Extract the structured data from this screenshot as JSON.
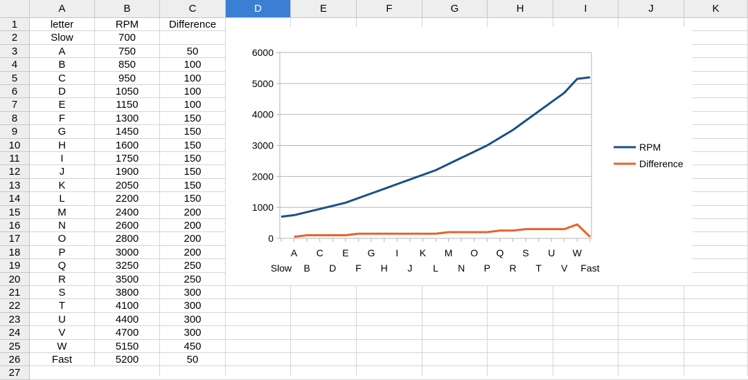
{
  "columns": [
    "A",
    "B",
    "C",
    "D",
    "E",
    "F",
    "G",
    "H",
    "I",
    "J",
    "K"
  ],
  "selected_column": "D",
  "row_numbers": [
    "1",
    "2",
    "3",
    "4",
    "5",
    "6",
    "7",
    "8",
    "9",
    "10",
    "11",
    "12",
    "13",
    "14",
    "15",
    "16",
    "17",
    "18",
    "19",
    "20",
    "21",
    "22",
    "23",
    "24",
    "25",
    "26",
    "27"
  ],
  "table": {
    "headers": [
      "letter",
      "RPM",
      "Difference"
    ],
    "rows": [
      [
        "Slow",
        "700",
        ""
      ],
      [
        "A",
        "750",
        "50"
      ],
      [
        "B",
        "850",
        "100"
      ],
      [
        "C",
        "950",
        "100"
      ],
      [
        "D",
        "1050",
        "100"
      ],
      [
        "E",
        "1150",
        "100"
      ],
      [
        "F",
        "1300",
        "150"
      ],
      [
        "G",
        "1450",
        "150"
      ],
      [
        "H",
        "1600",
        "150"
      ],
      [
        "I",
        "1750",
        "150"
      ],
      [
        "J",
        "1900",
        "150"
      ],
      [
        "K",
        "2050",
        "150"
      ],
      [
        "L",
        "2200",
        "150"
      ],
      [
        "M",
        "2400",
        "200"
      ],
      [
        "N",
        "2600",
        "200"
      ],
      [
        "O",
        "2800",
        "200"
      ],
      [
        "P",
        "3000",
        "200"
      ],
      [
        "Q",
        "3250",
        "250"
      ],
      [
        "R",
        "3500",
        "250"
      ],
      [
        "S",
        "3800",
        "300"
      ],
      [
        "T",
        "4100",
        "300"
      ],
      [
        "U",
        "4400",
        "300"
      ],
      [
        "V",
        "4700",
        "300"
      ],
      [
        "W",
        "5150",
        "450"
      ],
      [
        "Fast",
        "5200",
        "50"
      ]
    ]
  },
  "chart_data": {
    "type": "line",
    "categories": [
      "Slow",
      "A",
      "B",
      "C",
      "D",
      "E",
      "F",
      "G",
      "H",
      "I",
      "J",
      "K",
      "L",
      "M",
      "N",
      "O",
      "P",
      "Q",
      "R",
      "S",
      "T",
      "U",
      "V",
      "W",
      "Fast"
    ],
    "series": [
      {
        "name": "RPM",
        "color": "#1a4f86",
        "values": [
          700,
          750,
          850,
          950,
          1050,
          1150,
          1300,
          1450,
          1600,
          1750,
          1900,
          2050,
          2200,
          2400,
          2600,
          2800,
          3000,
          3250,
          3500,
          3800,
          4100,
          4400,
          4700,
          5150,
          5200
        ]
      },
      {
        "name": "Difference",
        "color": "#e8622a",
        "values": [
          null,
          50,
          100,
          100,
          100,
          100,
          150,
          150,
          150,
          150,
          150,
          150,
          150,
          200,
          200,
          200,
          200,
          250,
          250,
          300,
          300,
          300,
          300,
          450,
          50
        ]
      }
    ],
    "ylim": [
      0,
      6000
    ],
    "yticks": [
      "0",
      "1000",
      "2000",
      "3000",
      "4000",
      "5000",
      "6000"
    ],
    "grid": true,
    "legend": "right"
  }
}
